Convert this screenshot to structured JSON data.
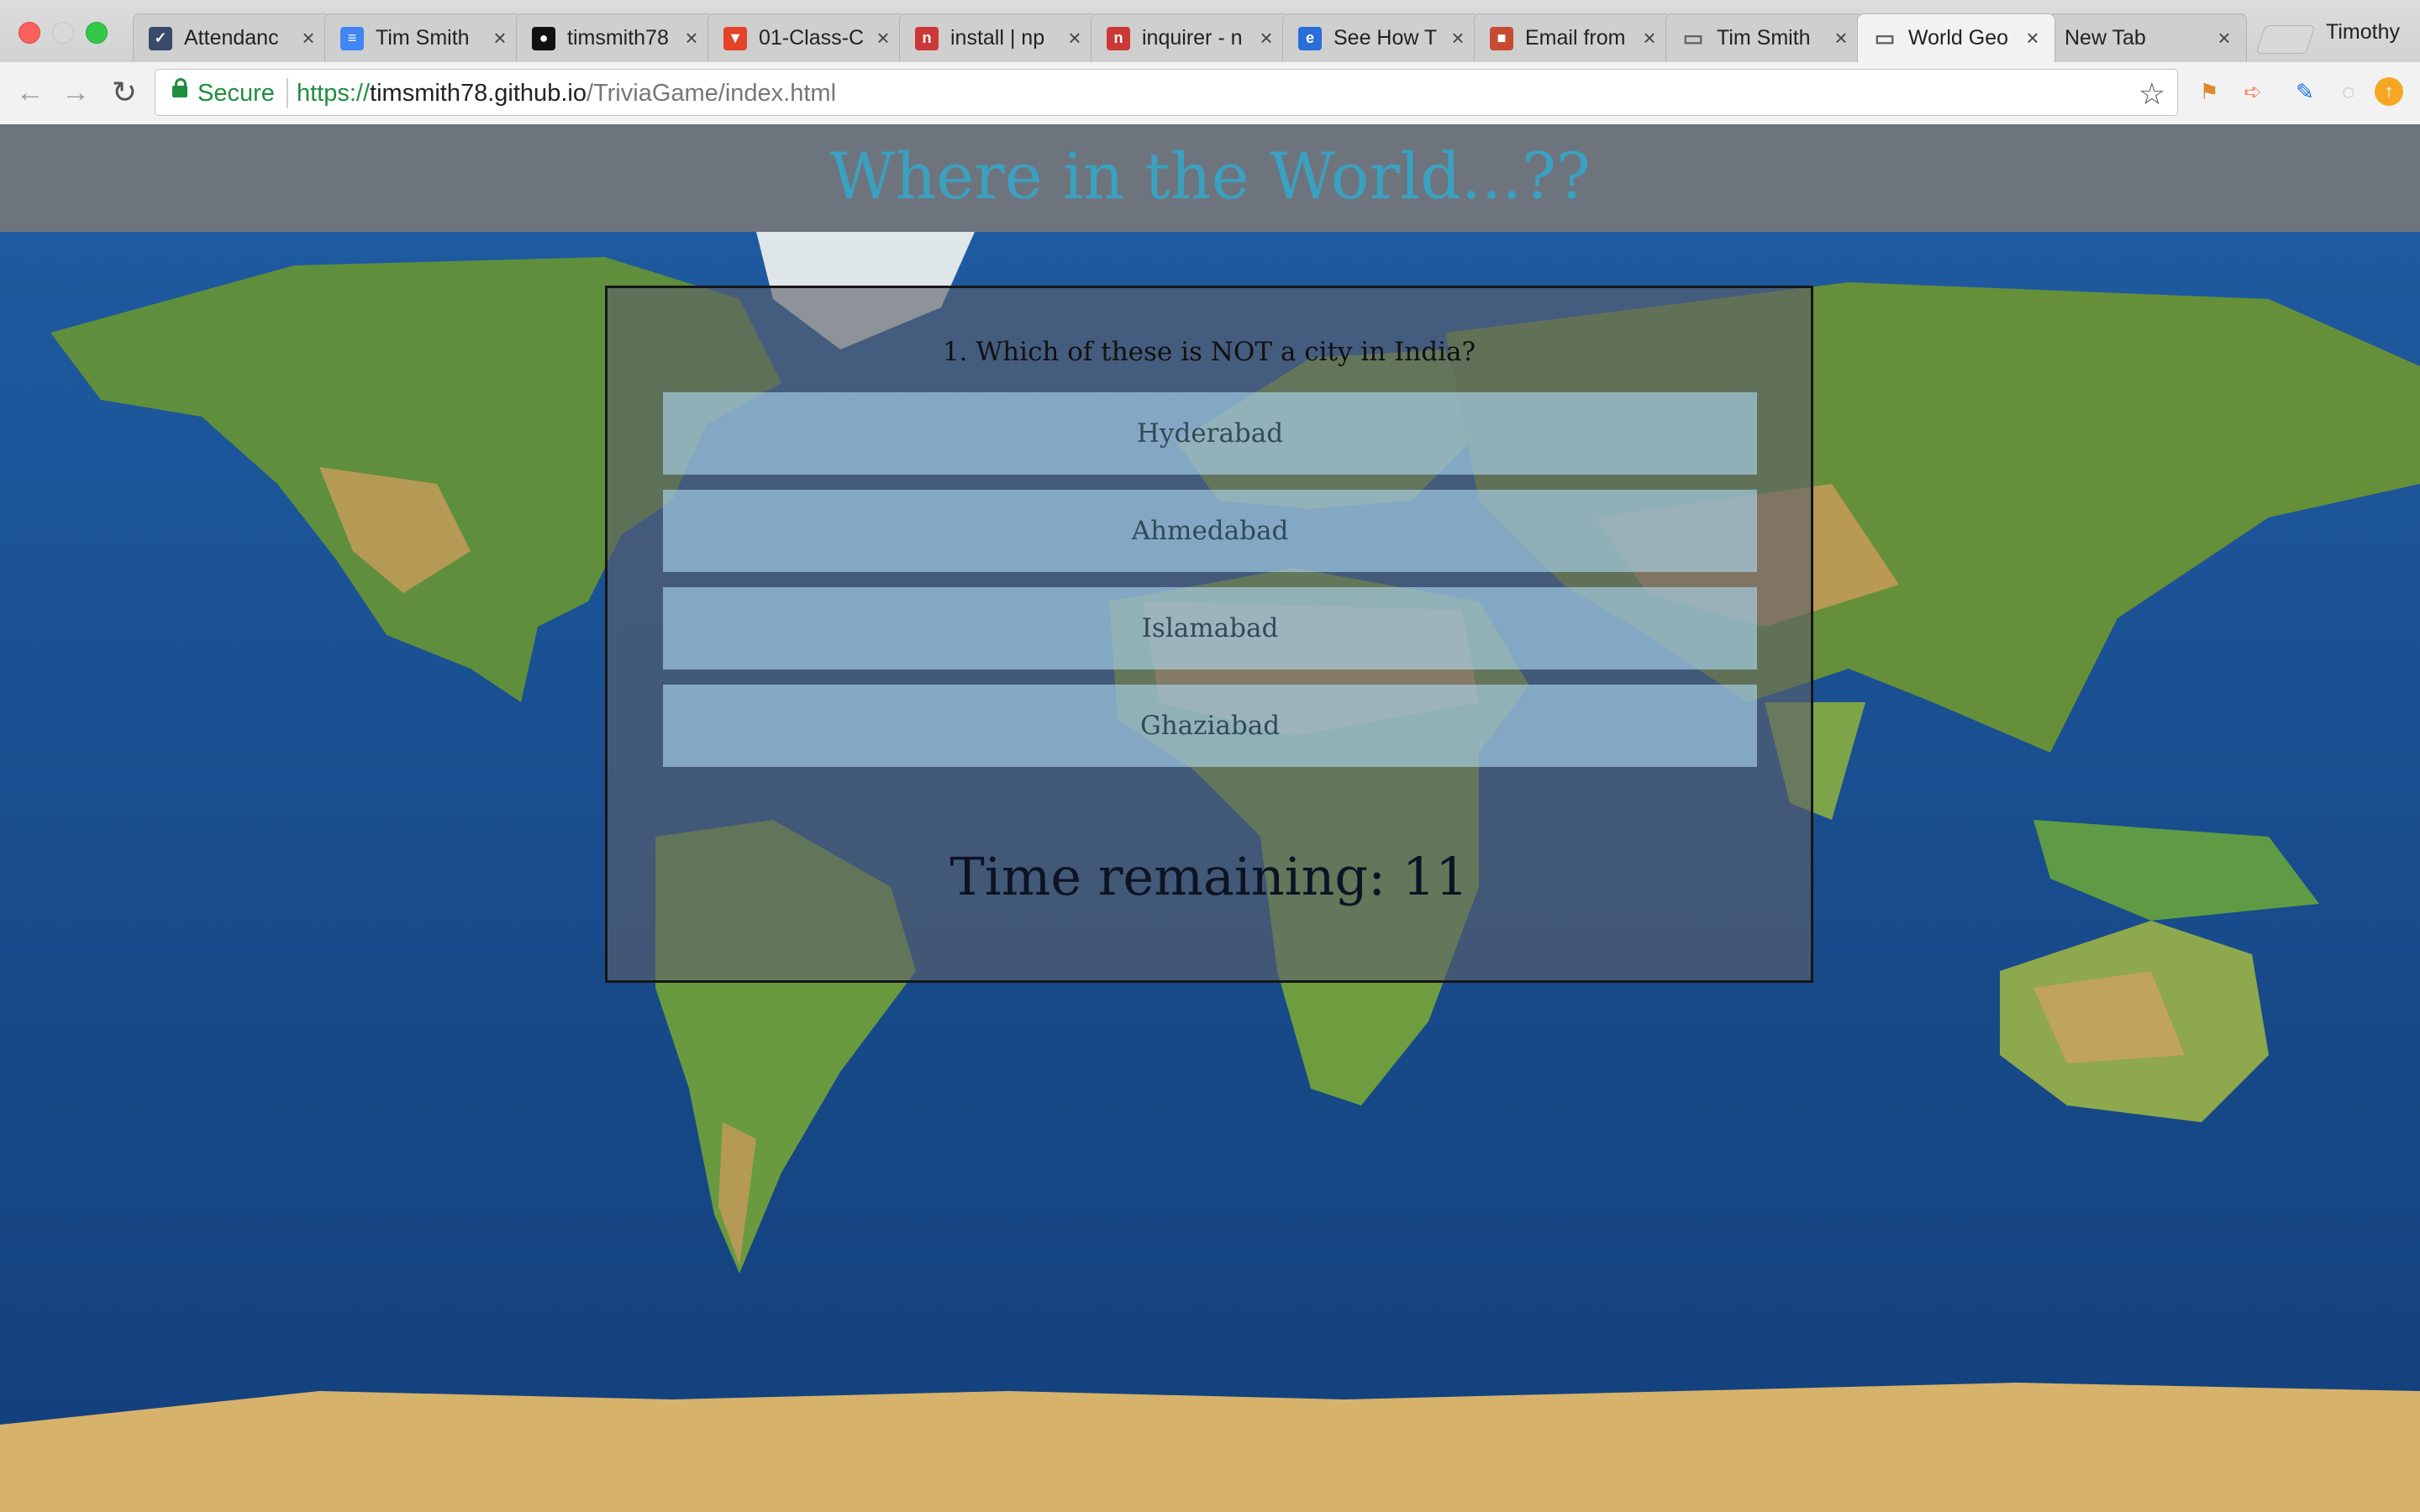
{
  "browser": {
    "tabs": [
      {
        "label": "Attendanc",
        "icon": "shield-check-icon",
        "color": "#3b4a6b"
      },
      {
        "label": "Tim Smith",
        "icon": "google-docs-icon",
        "color": "#4285f4"
      },
      {
        "label": "timsmith78",
        "icon": "github-icon",
        "color": "#111111"
      },
      {
        "label": "01-Class-C",
        "icon": "gitlab-icon",
        "color": "#e24329"
      },
      {
        "label": "install | np",
        "icon": "npm-icon",
        "color": "#cb3837"
      },
      {
        "label": "inquirer - n",
        "icon": "npm-icon",
        "color": "#cb3837"
      },
      {
        "label": "See How T",
        "icon": "browser-logo-icon",
        "color": "#2a6fd8"
      },
      {
        "label": "Email from",
        "icon": "cube-icon",
        "color": "#c84b31"
      },
      {
        "label": "Tim Smith",
        "icon": "page-icon",
        "color": "#666666"
      },
      {
        "label": "World Geo",
        "icon": "page-icon",
        "color": "#666666"
      },
      {
        "label": "New Tab",
        "icon": "",
        "color": ""
      }
    ],
    "active_tab_index": 9,
    "tab_close_glyph": "×",
    "profile_name": "Timothy",
    "secure_label": "Secure",
    "url": {
      "scheme": "https://",
      "host": "timsmith78.github.io",
      "path": "/TriviaGame/index.html"
    }
  },
  "page": {
    "title": "Where in the World...??",
    "question": "1. Which of these is NOT a city in India?",
    "answers": [
      "Hyderabad",
      "Ahmedabad",
      "Islamabad",
      "Ghaziabad"
    ],
    "timer_label": "Time remaining:",
    "timer_value": "11"
  },
  "colors": {
    "title": "#3aa1c0",
    "header_bg": "#6e747e",
    "ocean": "#1a4f8f"
  }
}
